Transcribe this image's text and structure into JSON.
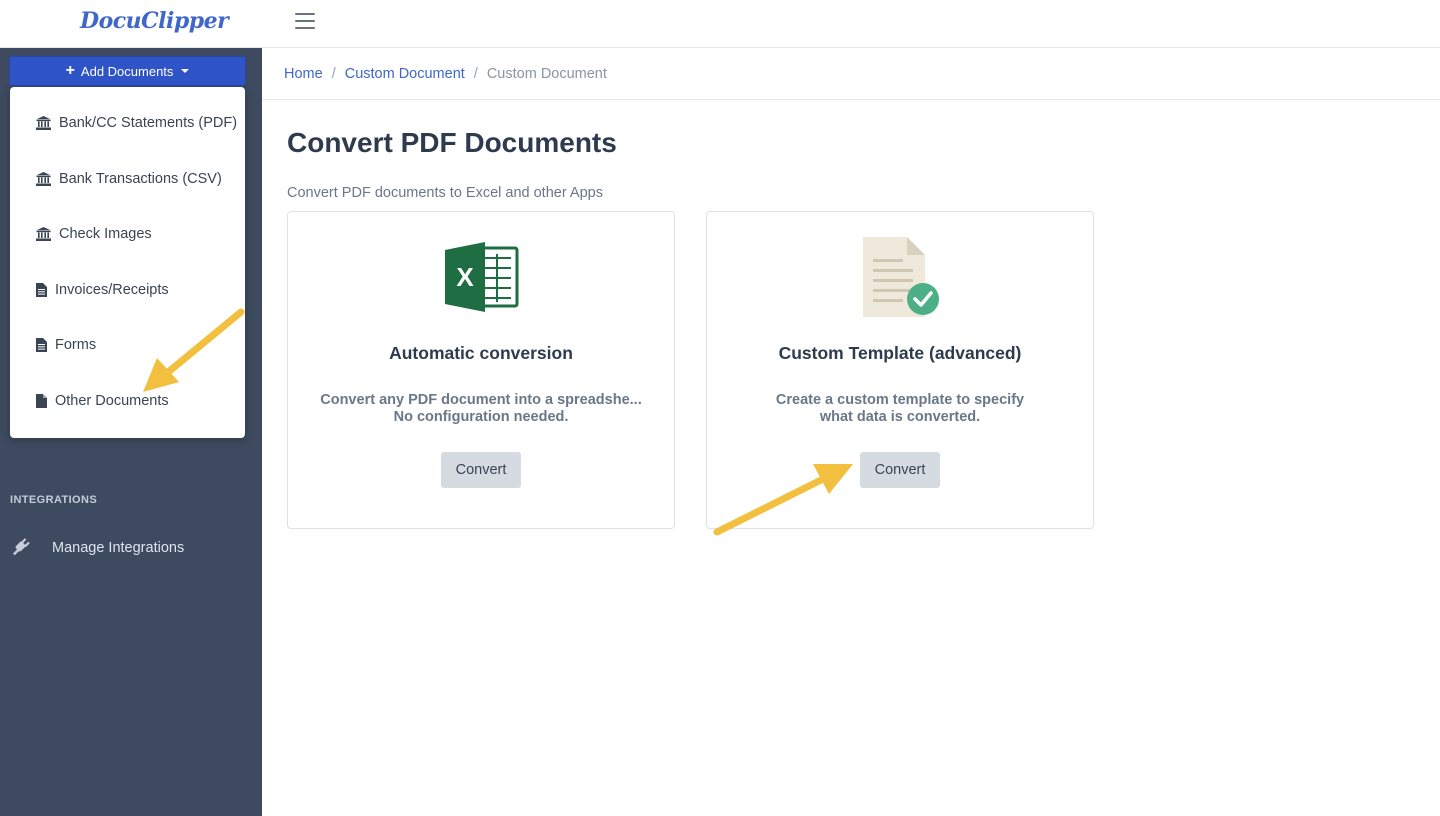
{
  "app": {
    "logo_text": "DocuClipper"
  },
  "sidebar": {
    "add_button_label": "Add Documents",
    "dropdown_items": [
      {
        "label": "Bank/CC Statements (PDF)",
        "icon": "bank-icon"
      },
      {
        "label": "Bank Transactions (CSV)",
        "icon": "bank-icon"
      },
      {
        "label": "Check Images",
        "icon": "bank-icon"
      },
      {
        "label": "Invoices/Receipts",
        "icon": "document-icon"
      },
      {
        "label": "Forms",
        "icon": "document-icon"
      },
      {
        "label": "Other Documents",
        "icon": "file-icon"
      }
    ],
    "section_label": "INTEGRATIONS",
    "manage_integrations_label": "Manage Integrations"
  },
  "breadcrumb": {
    "home": "Home",
    "link": "Custom Document",
    "current": "Custom Document"
  },
  "main": {
    "title": "Convert PDF Documents",
    "subtitle": "Convert PDF documents to Excel and other Apps",
    "cards": [
      {
        "title": "Automatic conversion",
        "desc_line1": "Convert any PDF document into a spreadshe...",
        "desc_line2": "No configuration needed.",
        "button": "Convert",
        "icon": "excel-icon"
      },
      {
        "title": "Custom Template (advanced)",
        "desc_line1": "Create a custom template to specify",
        "desc_line2": "what data is converted.",
        "button": "Convert",
        "icon": "document-check-icon"
      }
    ]
  },
  "colors": {
    "sidebar_bg": "#3d4a5f",
    "primary": "#2f54c7",
    "link": "#3f66c9",
    "annotation_arrow": "#f2bf3e",
    "excel_green": "#1f6e43",
    "check_green": "#4caf86"
  }
}
